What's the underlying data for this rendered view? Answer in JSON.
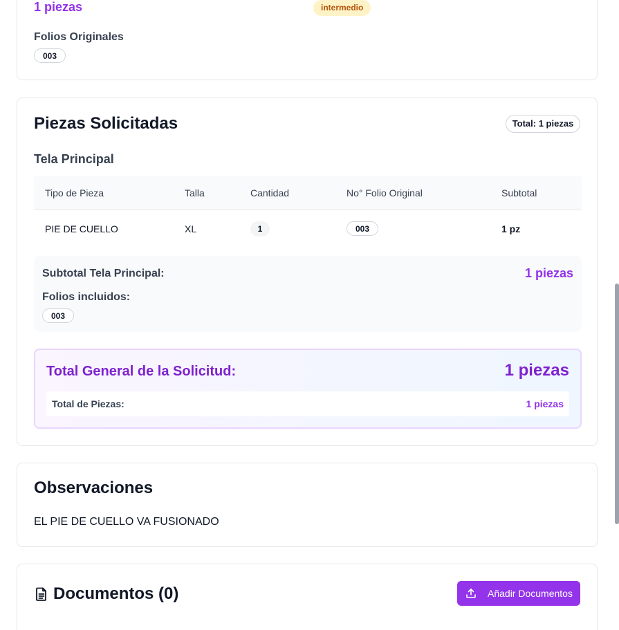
{
  "top_card": {
    "pieces_total": "1 piezas",
    "difficulty_badge": "intermedio",
    "folios_label": "Folios Originales",
    "folios": [
      "003"
    ]
  },
  "piezas_card": {
    "title": "Piezas Solicitadas",
    "total_badge": "Total: 1 piezas",
    "section_title": "Tela Principal",
    "columns": [
      "Tipo de Pieza",
      "Talla",
      "Cantidad",
      "No° Folio Original",
      "Subtotal"
    ],
    "rows": [
      {
        "tipo": "PIE DE CUELLO",
        "talla": "XL",
        "cantidad": "1",
        "folio": "003",
        "subtotal": "1 pz"
      }
    ],
    "subtotal_label": "Subtotal Tela Principal:",
    "subtotal_value": "1 piezas",
    "folios_incluidos_label": "Folios incluidos:",
    "folios_incluidos": [
      "003"
    ],
    "total_general_label": "Total General de la Solicitud:",
    "total_general_value": "1 piezas",
    "total_piezas_label": "Total de Piezas:",
    "total_piezas_value": "1 piezas"
  },
  "observaciones_card": {
    "title": "Observaciones",
    "text": "EL PIE DE CUELLO VA FUSIONADO"
  },
  "documentos_card": {
    "title": "Documentos (0)",
    "icon": "document-icon",
    "add_button_label": "Añadir Documentos",
    "add_button_icon": "upload-icon"
  },
  "colors": {
    "accent": "#9333ea",
    "accent_dark": "#7e22ce",
    "badge_yellow_bg": "#fef3c7",
    "badge_yellow_text": "#b45309"
  }
}
